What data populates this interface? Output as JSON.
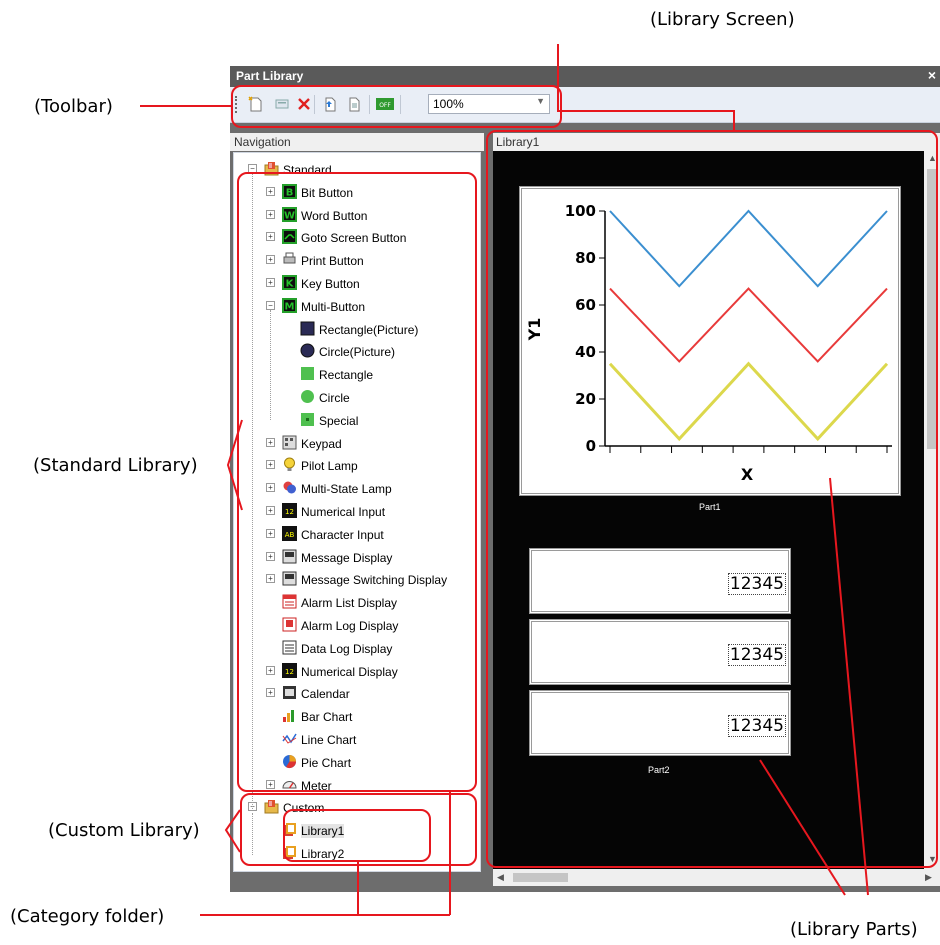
{
  "window": {
    "title": "Part Library",
    "close_glyph": "×"
  },
  "toolbar": {
    "zoom_value": "100%"
  },
  "navigation": {
    "header": "Navigation"
  },
  "library_panel": {
    "header": "Library1"
  },
  "tree": {
    "standard": "Standard",
    "items": [
      "Bit Button",
      "Word Button",
      "Goto Screen Button",
      "Print Button",
      "Key Button",
      "Multi-Button"
    ],
    "multi_children": [
      "Rectangle(Picture)",
      "Circle(Picture)",
      "Rectangle",
      "Circle",
      "Special"
    ],
    "items2": [
      "Keypad",
      "Pilot Lamp",
      "Multi-State Lamp",
      "Numerical Input",
      "Character Input",
      "Message Display",
      "Message Switching Display",
      "Alarm List Display",
      "Alarm Log Display",
      "Data Log Display",
      "Numerical Display",
      "Calendar",
      "Bar Chart",
      "Line Chart",
      "Pie Chart",
      "Meter"
    ],
    "custom": "Custom",
    "custom_items": [
      "Library1",
      "Library2"
    ]
  },
  "parts": {
    "part1_caption": "Part1",
    "part2_caption": "Part2",
    "numeric_value": "12345",
    "chart": {
      "ylabel": "Y1",
      "xlabel": "X",
      "yticks": [
        "0",
        "20",
        "40",
        "60",
        "80",
        "100"
      ]
    }
  },
  "chart_data": {
    "type": "line",
    "ylabel": "Y1",
    "xlabel": "X",
    "ylim": [
      0,
      100
    ],
    "x": [
      0,
      1,
      2,
      3,
      4
    ],
    "series": [
      {
        "values": [
          100,
          68,
          100,
          68,
          100
        ],
        "color": "#3b8fd0"
      },
      {
        "values": [
          67,
          36,
          67,
          36,
          67
        ],
        "color": "#e83a3a"
      },
      {
        "values": [
          35,
          3,
          35,
          3,
          35
        ],
        "color": "#dcd84c"
      }
    ]
  },
  "annotations": {
    "library_screen": "(Library Screen)",
    "toolbar": "(Toolbar)",
    "standard_library": "(Standard Library)",
    "custom_library": "(Custom Library)",
    "category_folder": "(Category folder)",
    "library_parts": "(Library Parts)"
  },
  "colors": {
    "annotation_red": "#e6171e"
  }
}
